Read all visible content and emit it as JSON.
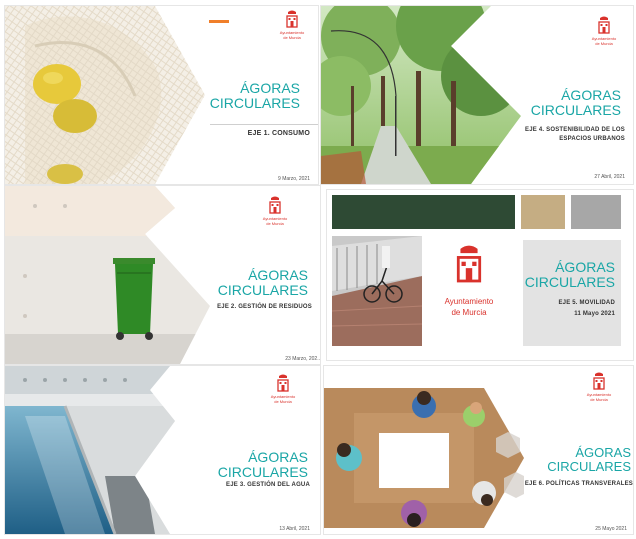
{
  "colors": {
    "teal": "#1aa6a6",
    "red": "#d9322c",
    "dark_green": "#2e4a34",
    "gold": "#c5ad83",
    "gray": "#a7a7a7",
    "accent_orange": "#f07f2a"
  },
  "slides": [
    {
      "title_line1": "ÁGORAS",
      "title_line2": "CIRCULARES",
      "subtitle": "EJE 1. CONSUMO",
      "date": "9 Marzo, 2021",
      "org": "Ayuntamiento\nde Murcia",
      "photo": "lemons-in-mesh-bag"
    },
    {
      "title_line1": "ÁGORAS",
      "title_line2": "CIRCULARES",
      "subtitle_line1": "EJE 4. SOSTENIBILIDAD DE LOS",
      "subtitle_line2": "ESPACIOS URBANOS",
      "date": "27 Abril, 2021",
      "org": "Ayuntamiento\nde Murcia",
      "photo": "tree-lined-park-path"
    },
    {
      "title_line1": "ÁGORAS",
      "title_line2": "CIRCULARES",
      "subtitle": "EJE 2. GESTIÓN DE RESIDUOS",
      "date": "23 Marzo, 202..",
      "org": "Ayuntamiento\nde Murcia",
      "photo": "green-waste-bin"
    },
    {
      "title_line1": "ÁGORAS",
      "title_line2": "CIRCULARES",
      "subtitle": "EJE 5. MOVILIDAD",
      "date": "11 Mayo 2021",
      "org_line1": "Ayuntamiento",
      "org_line2": "de Murcia",
      "photo": "cyclist-on-path"
    },
    {
      "title_line1": "ÁGORAS",
      "title_line2": "CIRCULARES",
      "subtitle": "EJE 3. GESTIÓN DEL AGUA",
      "date": "13 Abril, 2021",
      "org": "Ayuntamiento\nde Murcia",
      "photo": "water-channel"
    },
    {
      "title_line1": "ÁGORAS",
      "title_line2": "CIRCULARES",
      "subtitle": "EJE 6. POLÍTICAS TRANSVERALES",
      "date": "25 Mayo 2021",
      "org": "Ayuntamiento\nde Murcia",
      "photo": "meeting-table-overhead"
    }
  ]
}
